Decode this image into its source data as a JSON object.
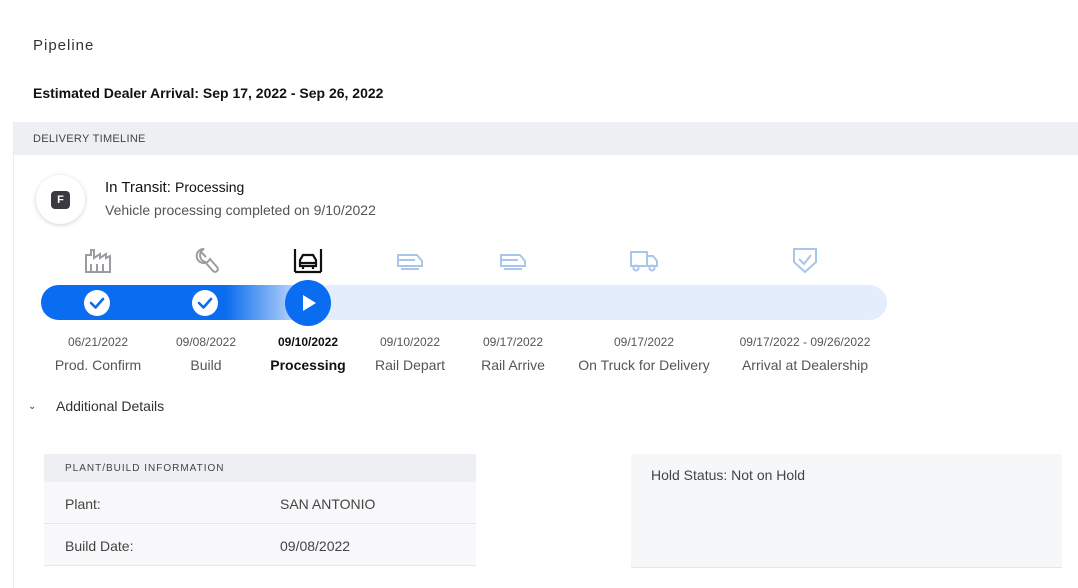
{
  "page": {
    "title": "Pipeline",
    "eta_label": "Estimated Dealer Arrival: Sep 17, 2022 - Sep 26, 2022"
  },
  "timeline": {
    "header": "DELIVERY TIMELINE",
    "status": {
      "badge_letter": "F",
      "stage_label": "In Transit:",
      "stage_value": "Processing",
      "detail": "Vehicle processing completed on 9/10/2022"
    },
    "progress_fraction": 0.32,
    "accent_color": "#0a6cf0",
    "steps": [
      {
        "date": "06/21/2022",
        "label": "Prod. Confirm",
        "icon": "factory-icon",
        "state": "done"
      },
      {
        "date": "09/08/2022",
        "label": "Build",
        "icon": "wrench-icon",
        "state": "done"
      },
      {
        "date": "09/10/2022",
        "label": "Processing",
        "icon": "car-wash-icon",
        "state": "current"
      },
      {
        "date": "09/10/2022",
        "label": "Rail Depart",
        "icon": "rail-car-icon",
        "state": "pending"
      },
      {
        "date": "09/17/2022",
        "label": "Rail Arrive",
        "icon": "rail-car-icon",
        "state": "pending"
      },
      {
        "date": "09/17/2022",
        "label": "On Truck for Delivery",
        "icon": "truck-icon",
        "state": "pending"
      },
      {
        "date": "09/17/2022 - 09/26/2022",
        "label": "Arrival at Dealership",
        "icon": "shield-check-icon",
        "state": "pending"
      }
    ]
  },
  "details": {
    "toggle_label": "Additional Details",
    "plant_section": {
      "header": "PLANT/BUILD INFORMATION",
      "rows": [
        {
          "key": "Plant:",
          "value": "SAN ANTONIO"
        },
        {
          "key": "Build Date:",
          "value": "09/08/2022"
        }
      ]
    },
    "hold_status": "Hold Status: Not on Hold"
  }
}
